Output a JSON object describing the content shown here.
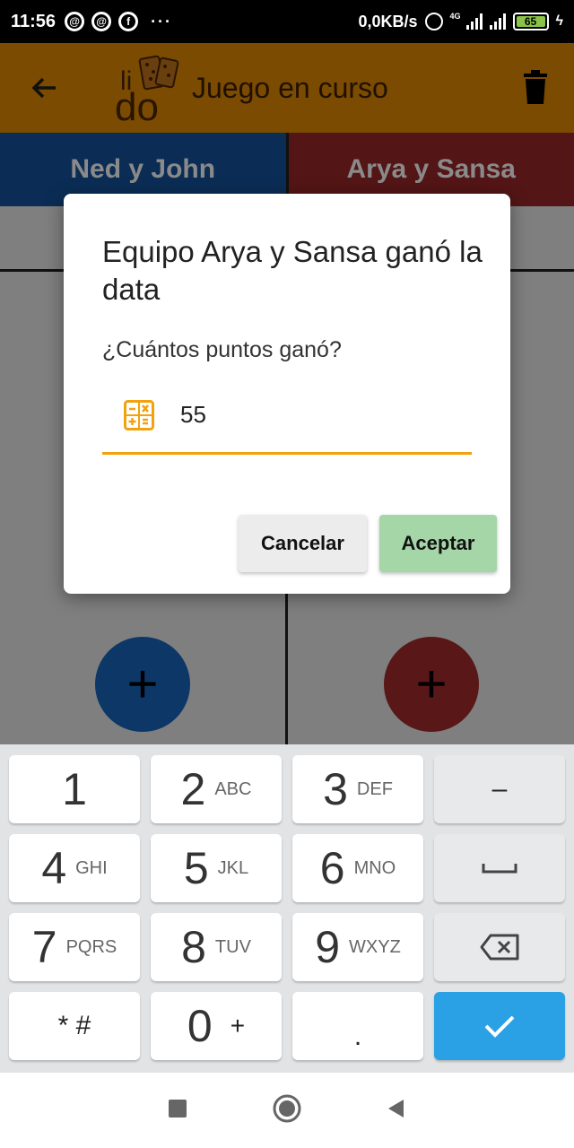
{
  "status_bar": {
    "time": "11:56",
    "data_speed": "0,0KB/s",
    "network_label": "4G",
    "battery": "65"
  },
  "app_bar": {
    "title": "Juego en curso",
    "logo_text": "li do"
  },
  "teams": {
    "left": {
      "name": "Ned y John",
      "color": "#0b2d55"
    },
    "right": {
      "name": "Arya y Sansa",
      "color": "#541516"
    }
  },
  "dialog": {
    "title": "Equipo Arya y Sansa ganó la data",
    "question": "¿Cuántos puntos ganó?",
    "points_value": "55",
    "cancel_label": "Cancelar",
    "accept_label": "Aceptar",
    "accent_color": "#f2a20c",
    "accept_color": "#a5d6a7"
  },
  "keyboard": {
    "rows": [
      [
        {
          "num": "1",
          "letters": ""
        },
        {
          "num": "2",
          "letters": "ABC"
        },
        {
          "num": "3",
          "letters": "DEF"
        },
        {
          "sym": "–"
        }
      ],
      [
        {
          "num": "4",
          "letters": "GHI"
        },
        {
          "num": "5",
          "letters": "JKL"
        },
        {
          "num": "6",
          "letters": "MNO"
        },
        {
          "sym": "␣"
        }
      ],
      [
        {
          "num": "7",
          "letters": "PQRS"
        },
        {
          "num": "8",
          "letters": "TUV"
        },
        {
          "num": "9",
          "letters": "WXYZ"
        },
        {
          "sym": "⌫"
        }
      ],
      [
        {
          "sym": "* #"
        },
        {
          "num": "0",
          "letters": "+"
        },
        {
          "sym": "."
        },
        {
          "sym": "✓"
        }
      ]
    ],
    "done_color": "#2aa0e5"
  }
}
